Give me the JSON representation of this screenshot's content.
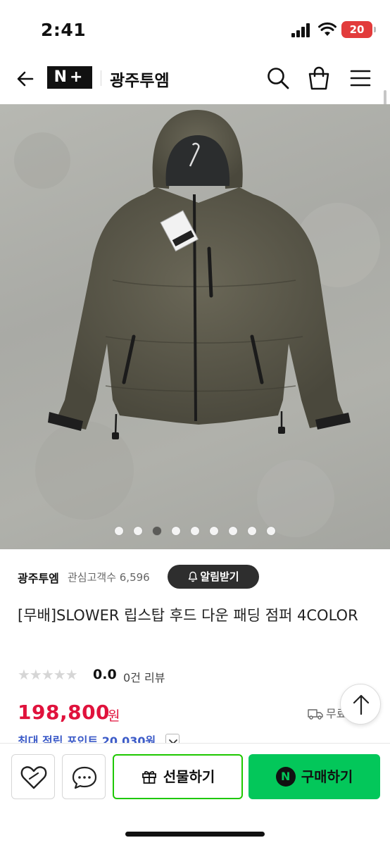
{
  "status_bar": {
    "time": "2:41",
    "battery": "20"
  },
  "nav": {
    "logo": "N+",
    "store_name": "광주투엠",
    "icons": [
      "back-arrow-icon",
      "search-icon",
      "shopping-bag-icon",
      "hamburger-menu-icon"
    ]
  },
  "gallery": {
    "image_count": 9,
    "active_index": 3,
    "expand_icon": "expand-arrows-icon"
  },
  "store": {
    "name": "광주투엠",
    "followers_text": "관심고객수 6,596",
    "follow_button": "알림받기"
  },
  "product": {
    "title": "[무배]SLOWER 립스탑 후드 다운 패딩 점퍼 4COLOR",
    "stars": "★★★★★",
    "rating": "0.0",
    "reviews": "0건 리뷰",
    "price": "198,800",
    "price_unit": "원",
    "shipping": "무료배송",
    "points": "최대 적립 포인트 20,030원"
  },
  "bottom_bar": {
    "gift_label": "선물하기",
    "buy_label": "구매하기",
    "buy_badge": "N"
  },
  "colors": {
    "price": "#e0123c",
    "naver_green": "#03c75a",
    "points": "#3c5bc8"
  }
}
